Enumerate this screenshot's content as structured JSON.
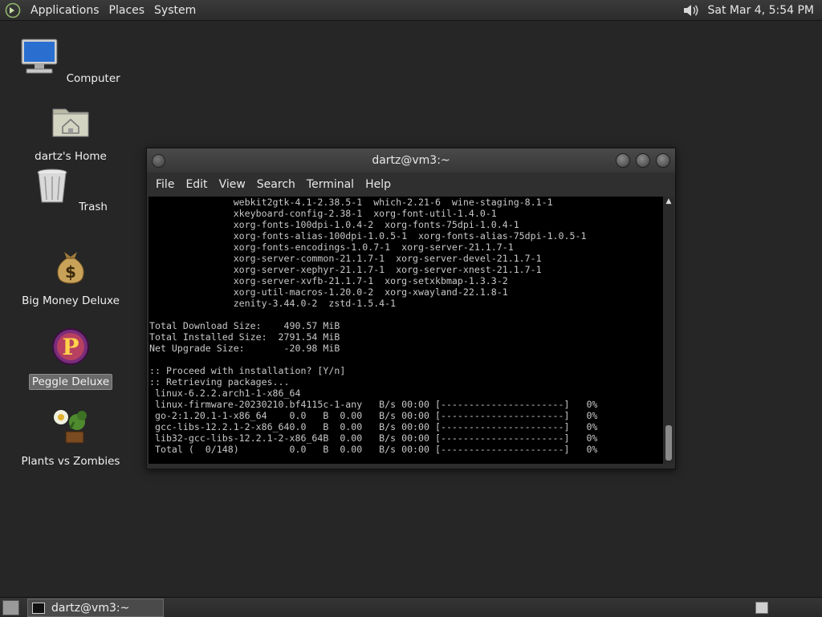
{
  "top_panel": {
    "menus": [
      "Applications",
      "Places",
      "System"
    ],
    "icons": {
      "logo": "gnome-foot-icon",
      "volume": "speaker-icon"
    },
    "clock": "Sat Mar  4,  5:54 PM"
  },
  "desktop_icons": [
    {
      "label": "Computer",
      "icon": "computer-icon"
    },
    {
      "label": "dartz's Home",
      "icon": "home-folder-icon"
    },
    {
      "label": "Trash",
      "icon": "trash-icon"
    },
    {
      "label": "Big Money Deluxe",
      "icon": "money-bag-icon"
    },
    {
      "label": "Peggle Deluxe",
      "icon": "peggle-icon",
      "selected": true
    },
    {
      "label": "Plants vs Zombies",
      "icon": "plants-vs-zombies-icon"
    }
  ],
  "terminal": {
    "title": "dartz@vm3:~",
    "menu": [
      "File",
      "Edit",
      "View",
      "Search",
      "Terminal",
      "Help"
    ],
    "lines": [
      "               webkit2gtk-4.1-2.38.5-1  which-2.21-6  wine-staging-8.1-1",
      "               xkeyboard-config-2.38-1  xorg-font-util-1.4.0-1",
      "               xorg-fonts-100dpi-1.0.4-2  xorg-fonts-75dpi-1.0.4-1",
      "               xorg-fonts-alias-100dpi-1.0.5-1  xorg-fonts-alias-75dpi-1.0.5-1",
      "               xorg-fonts-encodings-1.0.7-1  xorg-server-21.1.7-1",
      "               xorg-server-common-21.1.7-1  xorg-server-devel-21.1.7-1",
      "               xorg-server-xephyr-21.1.7-1  xorg-server-xnest-21.1.7-1",
      "               xorg-server-xvfb-21.1.7-1  xorg-setxkbmap-1.3.3-2",
      "               xorg-util-macros-1.20.0-2  xorg-xwayland-22.1.8-1",
      "               zenity-3.44.0-2  zstd-1.5.4-1",
      "",
      "Total Download Size:    490.57 MiB",
      "Total Installed Size:  2791.54 MiB",
      "Net Upgrade Size:       -20.98 MiB",
      "",
      ":: Proceed with installation? [Y/n]",
      ":: Retrieving packages...",
      " linux-6.2.2.arch1-1-x86_64",
      " linux-firmware-20230210.bf4115c-1-any   B/s 00:00 [----------------------]   0%",
      " go-2:1.20.1-1-x86_64    0.0   B  0.00   B/s 00:00 [----------------------]   0%",
      " gcc-libs-12.2.1-2-x86_640.0   B  0.00   B/s 00:00 [----------------------]   0%",
      " lib32-gcc-libs-12.2.1-2-x86_64B  0.00   B/s 00:00 [----------------------]   0%",
      " Total (  0/148)         0.0   B  0.00   B/s 00:00 [----------------------]   0%"
    ]
  },
  "taskbar": {
    "window_button": "dartz@vm3:~",
    "icons": {
      "show_desktop": "show-desktop-icon",
      "task": "terminal-icon",
      "workspace": "workspace-switcher-icon"
    }
  }
}
